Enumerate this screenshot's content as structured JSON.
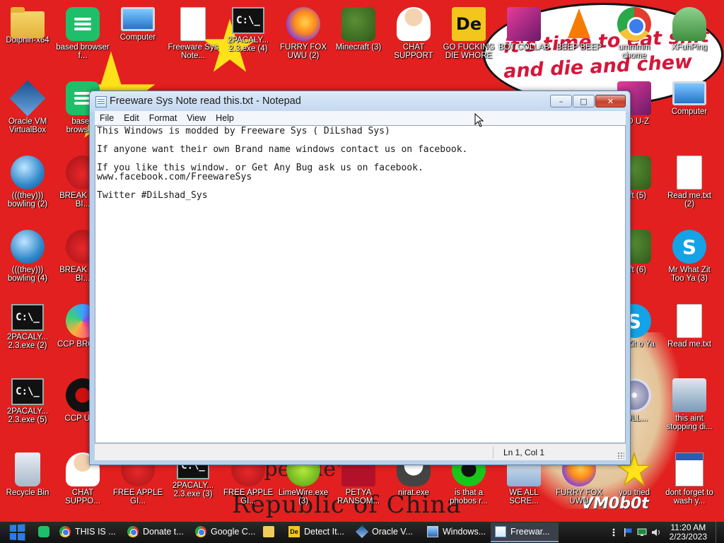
{
  "desktop": {
    "wallpaper": {
      "bubble_line1": "it's time to eat shit",
      "bubble_line2": "and die and chew",
      "caption_top": "mpeople's",
      "caption_bottom": "Republic of China",
      "signature": "VM0b0t"
    },
    "icons": [
      {
        "label": "Dolphin-x64",
        "icon": "folder-icon"
      },
      {
        "label": "based browser f...",
        "icon": "browser-icon"
      },
      {
        "label": "Computer",
        "icon": "computer-icon"
      },
      {
        "label": "Freeware Sys Note...",
        "icon": "text-document-icon"
      },
      {
        "label": "2PACALY... 2.3.exe (4)",
        "icon": "console-icon"
      },
      {
        "label": "FURRY FOX UWU (2)",
        "icon": "firefox-icon"
      },
      {
        "label": "Minecraft (3)",
        "icon": "minecraft-icon"
      },
      {
        "label": "CHAT SUPPORT",
        "icon": "doctor-icon"
      },
      {
        "label": "GO FUCKING DIE WHORE",
        "icon": "de-icon"
      },
      {
        "label": "BOT COLLAB",
        "icon": "monitor-icon"
      },
      {
        "label": "BEEP BEEP",
        "icon": "vlc-icon"
      },
      {
        "label": "ummmm chome",
        "icon": "chrome-icon"
      },
      {
        "label": "XFuhPing",
        "icon": "user-folder-icon"
      },
      {
        "label": "Oracle VM VirtualBox",
        "icon": "virtualbox-icon"
      },
      {
        "label": "based browse...",
        "icon": "browser-icon"
      },
      {
        "label": "UID U-Z",
        "icon": "cpuz-icon"
      },
      {
        "label": "Computer",
        "icon": "computer-icon"
      },
      {
        "label": "(((they))) bowling (2)",
        "icon": "bowling-icon"
      },
      {
        "label": "BREAK BAD BI...",
        "icon": "angry-bird-icon"
      },
      {
        "label": "raft (5)",
        "icon": "minecraft-icon"
      },
      {
        "label": "Read me.txt (2)",
        "icon": "text-document-icon"
      },
      {
        "label": "(((they))) bowling (4)",
        "icon": "bowling-icon"
      },
      {
        "label": "BREAK BAD BI...",
        "icon": "angry-bird-icon"
      },
      {
        "label": "raft (6)",
        "icon": "minecraft-icon"
      },
      {
        "label": "Mr What Zit Too Ya (3)",
        "icon": "skype-icon"
      },
      {
        "label": "2PACALY... 2.3.exe (2)",
        "icon": "console-icon"
      },
      {
        "label": "CCP BROW...",
        "icon": "browser-icon"
      },
      {
        "label": "hat Zit o Ya",
        "icon": "skype-icon"
      },
      {
        "label": "Read me.txt",
        "icon": "text-document-icon"
      },
      {
        "label": "2PACALY... 2.3.exe (5)",
        "icon": "console-icon"
      },
      {
        "label": "CCP UT...",
        "icon": "ccp-icon"
      },
      {
        "label": "BULL...",
        "icon": "disc-icon"
      },
      {
        "label": "this aint stopping di...",
        "icon": "setup-icon"
      },
      {
        "label": "Recycle Bin",
        "icon": "recycle-bin-icon"
      },
      {
        "label": "CHAT SUPPO...",
        "icon": "doctor-icon"
      },
      {
        "label": "FREE APPLE GI...",
        "icon": "apple-icon"
      },
      {
        "label": "2PACALY... 2.3.exe (3)",
        "icon": "console-icon"
      },
      {
        "label": "FREE APPLE GI...",
        "icon": "apple-icon"
      },
      {
        "label": "LimeWire.exe (3)",
        "icon": "limewire-icon"
      },
      {
        "label": "PETYA RANSOM...",
        "icon": "petya-icon"
      },
      {
        "label": "nirat.exe",
        "icon": "skull-icon"
      },
      {
        "label": "is that a phobos r...",
        "icon": "phobos-icon"
      },
      {
        "label": "WE ALL SCRE...",
        "icon": "monitor-icon"
      },
      {
        "label": "FURRY FOX UWU",
        "icon": "firefox-icon"
      },
      {
        "label": "you tried",
        "icon": "star-icon"
      },
      {
        "label": "dont forget to wash y...",
        "icon": "calendar-icon"
      }
    ]
  },
  "notepad": {
    "title": "Freeware Sys Note read this.txt - Notepad",
    "caption": {
      "minimize": "–",
      "maximize": "□",
      "close": "✕"
    },
    "menu": [
      "File",
      "Edit",
      "Format",
      "View",
      "Help"
    ],
    "content_lines": [
      "This Windows is modded by Freeware Sys ( DiLshad Sys)",
      "",
      "If anyone want their own Brand name windows contact us on facebook.",
      "",
      "If you like this window. or Get Any Bug ask us on facebook.",
      "www.facebook.com/FreewareSys",
      "",
      "Twitter #DiLshad_Sys"
    ],
    "status": "Ln 1, Col 1"
  },
  "taskbar": {
    "items": [
      {
        "label": "",
        "icon": "based-browser-icon"
      },
      {
        "label": "THIS IS ...",
        "icon": "chrome-icon"
      },
      {
        "label": "Donate t...",
        "icon": "chrome-icon"
      },
      {
        "label": "Google C...",
        "icon": "chrome-icon"
      },
      {
        "label": "",
        "icon": "folder-icon"
      },
      {
        "label": "Detect It...",
        "icon": "de-icon"
      },
      {
        "label": "Oracle V...",
        "icon": "virtualbox-icon"
      },
      {
        "label": "Windows...",
        "icon": "windows-icon"
      },
      {
        "label": "Freewar...",
        "icon": "notepad-icon"
      }
    ],
    "clock_time": "11:20 AM",
    "clock_date": "2/23/2023"
  },
  "colors": {
    "desktop_red": "#e2201f",
    "taskbar": "#111111",
    "title_gradient_top": "#dce9f7",
    "close_red": "#c3422e"
  }
}
